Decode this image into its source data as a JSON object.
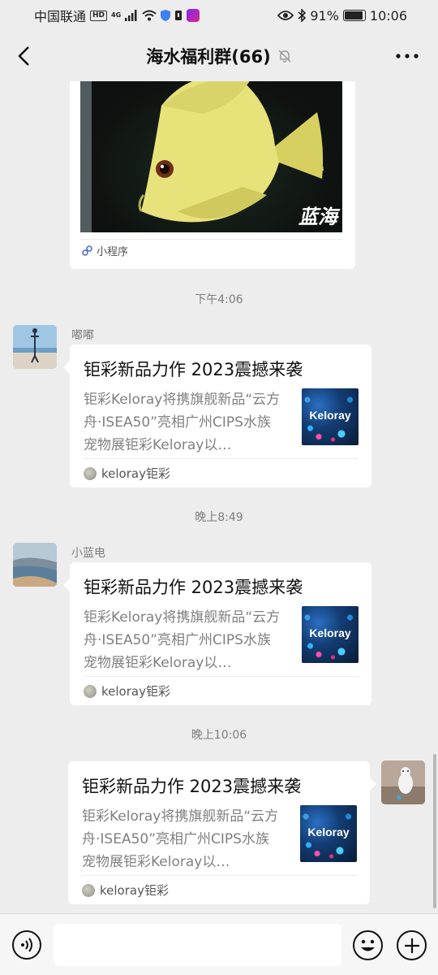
{
  "status_bar": {
    "carrier": "中国联通",
    "hd_badge": "HD",
    "network": "4G",
    "battery": "91%",
    "battery_level": 0.91,
    "time": "10:06"
  },
  "nav": {
    "title": "海水福利群(66)",
    "muted": true
  },
  "mini_program_card": {
    "image_watermark": "蓝海",
    "source_label": "小程序"
  },
  "messages": [
    {
      "time": "下午4:06",
      "sender": "嘟嘟",
      "side": "left",
      "card": {
        "title": "钜彩新品力作 2023震撼来袭",
        "desc": "钜彩Keloray将携旗舰新品“云方舟·ISEA50”亮相广州CIPS水族宠物展钜彩Keloray以…",
        "thumb_text": "Keloray",
        "source": "keloray钜彩"
      }
    },
    {
      "time": "晚上8:49",
      "sender": "小蓝电",
      "side": "left",
      "card": {
        "title": "钜彩新品力作 2023震撼来袭",
        "desc": "钜彩Keloray将携旗舰新品“云方舟·ISEA50”亮相广州CIPS水族宠物展钜彩Keloray以…",
        "thumb_text": "Keloray",
        "source": "keloray钜彩"
      }
    },
    {
      "time": "晚上10:06",
      "sender": "",
      "side": "right",
      "card": {
        "title": "钜彩新品力作 2023震撼来袭",
        "desc": "钜彩Keloray将携旗舰新品“云方舟·ISEA50”亮相广州CIPS水族宠物展钜彩Keloray以…",
        "thumb_text": "Keloray",
        "source": "keloray钜彩"
      }
    }
  ],
  "input_bar": {
    "value": "",
    "placeholder": ""
  },
  "icons": {
    "back": "chevron-left-icon",
    "mute": "bell-off-icon",
    "more": "more-dots-icon",
    "voice": "voice-icon",
    "emoji": "emoji-icon",
    "plus": "plus-icon"
  }
}
